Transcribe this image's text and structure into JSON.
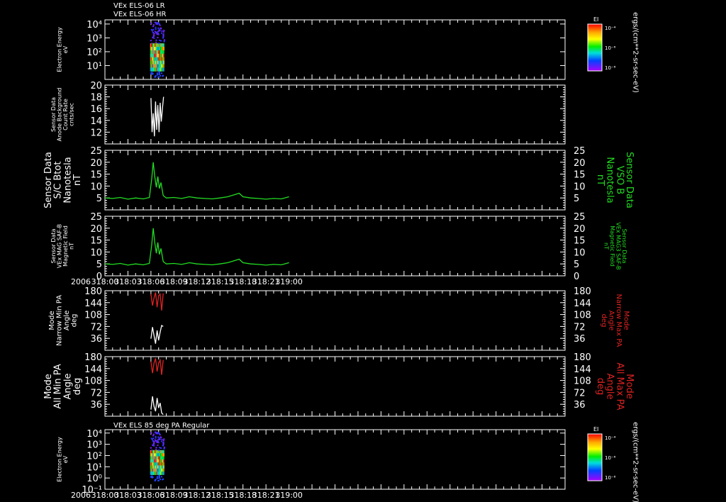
{
  "header": {
    "line1": "VEx ELS-06 LR",
    "line2": "VEx ELS-06 HR"
  },
  "time_axis": {
    "year_label": "2006",
    "ticks": [
      "318:00",
      "318:03",
      "318:06",
      "318:09",
      "318:12",
      "318:15",
      "318:18",
      "318:21",
      "319:00"
    ],
    "range_min": [
      0,
      60
    ],
    "minor_step_min": 1
  },
  "colorbar": {
    "title": "EI",
    "ticks": [
      "10⁻⁴",
      "10⁻⁶",
      "10⁻⁸"
    ],
    "unit_label": "ergs/(cm**2-sr-sec-eV)"
  },
  "panels": {
    "p1": {
      "ylabel": [
        "Electron Energy",
        "eV"
      ]
    },
    "p2": {
      "ylabel": [
        "Sensor Data",
        "Anode Background",
        "Count Rate",
        "cnts/sec"
      ]
    },
    "p3": {
      "ylabel": [
        "Sensor Data",
        "S/C Btot",
        "Nanotesla",
        "nT"
      ],
      "rlabel": [
        "Sensor Data",
        "VSO B",
        "Nanotesla",
        "nT"
      ]
    },
    "p4": {
      "ylabel": [
        "Sensor Data",
        "VEx MAG SAF-B",
        "Magnetic Field",
        "nT"
      ],
      "rlabel": [
        "Sensor Data",
        "VEx MAG3 SAF-B",
        "Magnetic Field",
        "nT"
      ]
    },
    "p5": {
      "ylabel": [
        "Mode",
        "Narrow Min PA",
        "Angle",
        "deg"
      ],
      "rlabel": [
        "Mode",
        "Narrow Max PA",
        "Angle",
        "deg"
      ]
    },
    "p6": {
      "ylabel": [
        "Mode",
        "All Min PA",
        "Angle",
        "deg"
      ],
      "rlabel": [
        "Mode",
        "All Max PA",
        "Angle",
        "deg"
      ]
    },
    "p7": {
      "title": "VEx ELS 85 deg PA Regular",
      "ylabel": [
        "Electron Energy",
        "eV"
      ]
    }
  },
  "chart_data": [
    {
      "type": "heatmap",
      "ylabel": "Electron Energy eV",
      "y_scale": "log",
      "ylim": [
        1,
        20000
      ],
      "y_ticks": [
        "10¹",
        "10²",
        "10³",
        "10⁴"
      ],
      "data_interval_min": [
        5.9,
        7.7
      ]
    },
    {
      "type": "line",
      "ylim": [
        10,
        20
      ],
      "y_ticks": [
        "12",
        "14",
        "16",
        "18",
        "20"
      ],
      "series": [
        {
          "color": "#ffffff",
          "x": [
            6.0,
            6.15,
            6.3,
            6.45,
            6.6,
            6.75,
            6.9,
            7.05,
            7.2,
            7.35,
            7.5,
            7.65
          ],
          "y": [
            17.8,
            12.0,
            15.2,
            11.3,
            17.2,
            12.4,
            16.6,
            12.0,
            17.0,
            13.8,
            16.0,
            18.0
          ]
        }
      ]
    },
    {
      "type": "line",
      "ylim": [
        0,
        25
      ],
      "y_ticks": [
        "5",
        "10",
        "15",
        "20",
        "25"
      ],
      "series": [
        {
          "color": "#22dd22",
          "x": [
            0,
            1,
            2,
            3,
            4,
            5,
            5.8,
            6.1,
            6.3,
            6.5,
            6.7,
            6.9,
            7.1,
            7.3,
            7.6,
            8,
            9,
            10,
            11,
            12,
            13,
            14,
            15,
            16,
            17,
            17.5,
            18,
            19,
            20,
            21,
            22,
            23,
            24
          ],
          "y": [
            5,
            4.8,
            5.2,
            4.5,
            5.0,
            4.6,
            5.2,
            13.0,
            20.0,
            14.0,
            9.5,
            14.0,
            9.0,
            11.5,
            6.0,
            5.0,
            5.2,
            4.8,
            5.5,
            5.0,
            4.8,
            4.6,
            5.0,
            5.5,
            6.5,
            7.0,
            5.5,
            5.0,
            4.8,
            4.5,
            4.8,
            4.6,
            5.5
          ]
        }
      ]
    },
    {
      "type": "line",
      "ylim": [
        0,
        25
      ],
      "y_ticks": [
        "0",
        "5",
        "10",
        "15",
        "20",
        "25"
      ],
      "series": [
        {
          "color": "#22dd22",
          "x": [
            0,
            1,
            2,
            3,
            4,
            5,
            5.8,
            6.1,
            6.3,
            6.5,
            6.7,
            6.9,
            7.1,
            7.3,
            7.6,
            8,
            9,
            10,
            11,
            12,
            13,
            14,
            15,
            16,
            17,
            17.5,
            18,
            19,
            20,
            21,
            22,
            23,
            24
          ],
          "y": [
            5,
            4.8,
            5.2,
            4.5,
            5.0,
            4.6,
            5.2,
            13.0,
            20.0,
            14.0,
            9.5,
            14.0,
            9.0,
            11.5,
            6.0,
            5.0,
            5.2,
            4.8,
            5.5,
            5.0,
            4.8,
            4.6,
            5.0,
            5.5,
            6.5,
            7.0,
            5.5,
            5.0,
            4.8,
            4.5,
            4.8,
            4.6,
            5.5
          ]
        }
      ]
    },
    {
      "type": "line",
      "ylim": [
        0,
        180
      ],
      "y_ticks": [
        "36",
        "72",
        "108",
        "144",
        "180"
      ],
      "series": [
        {
          "name": "Max PA",
          "color": "#dd2222",
          "x": [
            6.0,
            6.2,
            6.4,
            6.6,
            6.8,
            7.0,
            7.2,
            7.4,
            7.6
          ],
          "y": [
            170,
            135,
            158,
            175,
            130,
            165,
            170,
            120,
            172
          ]
        },
        {
          "name": "Min PA",
          "color": "#ffffff",
          "x": [
            6.0,
            6.2,
            6.4,
            6.6,
            6.8,
            7.0,
            7.2,
            7.4,
            7.6
          ],
          "y": [
            35,
            70,
            45,
            20,
            60,
            30,
            55,
            75,
            72
          ]
        }
      ]
    },
    {
      "type": "line",
      "ylim": [
        0,
        180
      ],
      "y_ticks": [
        "36",
        "72",
        "108",
        "144",
        "180"
      ],
      "series": [
        {
          "name": "Max PA",
          "color": "#dd2222",
          "x": [
            6.0,
            6.2,
            6.4,
            6.6,
            6.8,
            7.0,
            7.2,
            7.4,
            7.6
          ],
          "y": [
            165,
            130,
            160,
            175,
            135,
            160,
            170,
            125,
            170
          ]
        },
        {
          "name": "Min PA",
          "color": "#ffffff",
          "x": [
            6.0,
            6.2,
            6.4,
            6.6,
            6.8,
            7.0,
            7.2,
            7.4,
            7.6
          ],
          "y": [
            20,
            60,
            30,
            15,
            55,
            25,
            40,
            10,
            5
          ]
        }
      ]
    },
    {
      "type": "heatmap",
      "title": "VEx ELS 85 deg PA Regular",
      "ylabel": "Electron Energy eV",
      "y_scale": "log",
      "ylim": [
        0.1,
        20000
      ],
      "y_ticks": [
        "10⁻¹",
        "10⁰",
        "10¹",
        "10²",
        "10³",
        "10⁴"
      ],
      "data_interval_min": [
        5.9,
        7.7
      ]
    }
  ]
}
